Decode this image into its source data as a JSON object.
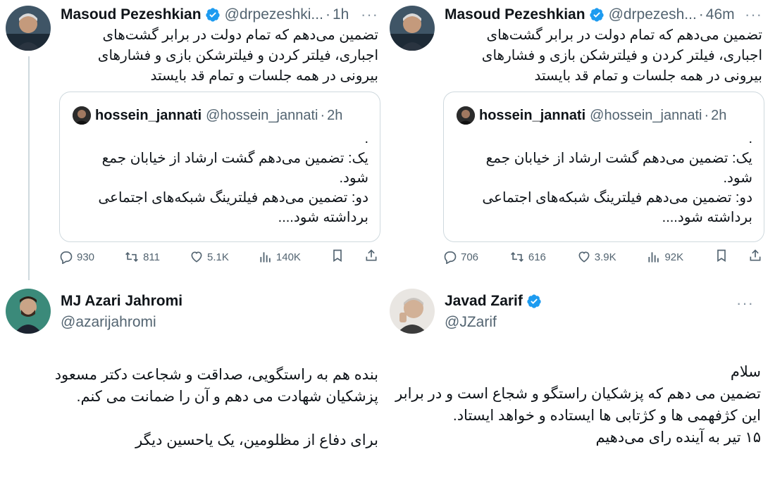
{
  "left": {
    "tweet": {
      "name": "Masoud Pezeshkian",
      "handle": "@drpezeshki...",
      "time": "1h",
      "text": "تضمین می‌دهم که تمام دولت در برابر  گشت‌های اجباری، فیلتر کردن و فیلترشکن بازی و فشارهای بیرونی در همه جلسات و تمام قد بایستد"
    },
    "quote": {
      "name": "hossein_jannati",
      "handle": "@hossein_jannati",
      "time": "2h",
      "text": ".\nیک: تضمین می‌دهم گشت ارشاد از خیابان جمع شود.\nدو: تضمین می‌دهم فیلترینگ شبکه‌های اجتماعی برداشته شود...."
    },
    "actions": {
      "replies": "930",
      "retweets": "811",
      "likes": "5.1K",
      "views": "140K"
    },
    "profile": {
      "name": "MJ Azari Jahromi",
      "handle": "@azarijahromi"
    },
    "statement": "بنده هم به راستگویی، صداقت و شجاعت دکتر مسعود پزشکیان شهادت می دهم و آن را ضمانت می کنم.\n\nبرای دفاع از مظلومین، یک یاحسین دیگر"
  },
  "right": {
    "tweet": {
      "name": "Masoud Pezeshkian",
      "handle": "@drpezesh...",
      "time": "46m",
      "text": "تضمین می‌دهم که تمام دولت در برابر  گشت‌های اجباری، فیلتر کردن و فیلترشکن بازی و فشارهای بیرونی در همه جلسات و تمام قد بایستد"
    },
    "quote": {
      "name": "hossein_jannati",
      "handle": "@hossein_jannati",
      "time": "2h",
      "text": ".\nیک: تضمین می‌دهم گشت ارشاد از خیابان جمع شود.\nدو: تضمین می‌دهم فیلترینگ شبکه‌های اجتماعی برداشته شود...."
    },
    "actions": {
      "replies": "706",
      "retweets": "616",
      "likes": "3.9K",
      "views": "92K"
    },
    "profile": {
      "name": "Javad Zarif",
      "handle": "@JZarif"
    },
    "statement": "سلام\nتضمین می دهم که پزشکیان راستگو و شجاع است و  در برابر این کژفهمی ها و کژتابی ها ایستاده و خواهد ایستاد.\n۱۵ تیر به آینده رای می‌دهیم"
  },
  "colors": {
    "verified": "#1d9bf0",
    "muted": "#536471",
    "text": "#0f1419",
    "border": "#cfd9de"
  },
  "icons": [
    "reply-icon",
    "retweet-icon",
    "like-icon",
    "views-icon",
    "bookmark-icon",
    "share-icon",
    "verified-icon",
    "more-icon"
  ]
}
